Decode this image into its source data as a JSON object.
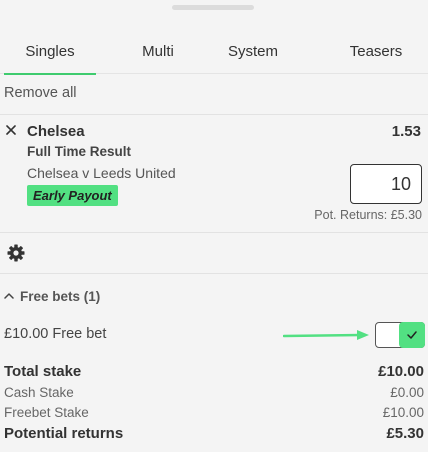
{
  "tabs": [
    {
      "label": "Singles",
      "active": true
    },
    {
      "label": "Multi",
      "active": false
    },
    {
      "label": "System",
      "active": false
    },
    {
      "label": "Teasers",
      "active": false
    }
  ],
  "remove_all_label": "Remove all",
  "bet": {
    "selection": "Chelsea",
    "odds": "1.53",
    "market": "Full Time Result",
    "event": "Chelsea v Leeds United",
    "badge": "Early Payout",
    "stake_value": "10",
    "potential_returns": "Pot. Returns: £5.30"
  },
  "free_bets": {
    "header": "Free bets (1)",
    "item_label": "£10.00 Free bet",
    "toggle_on": true
  },
  "summary": {
    "total_stake_label": "Total stake",
    "total_stake_value": "£10.00",
    "cash_stake_label": "Cash Stake",
    "cash_stake_value": "£0.00",
    "freebet_stake_label": "Freebet Stake",
    "freebet_stake_value": "£10.00",
    "potential_returns_label": "Potential returns",
    "potential_returns_value": "£5.30"
  },
  "colors": {
    "accent": "#3ecb6e",
    "badge": "#52e082",
    "background": "#f4f4f4"
  },
  "icons": [
    "close-icon",
    "gear-icon",
    "chevron-up-icon",
    "check-icon",
    "arrow-right-icon"
  ]
}
